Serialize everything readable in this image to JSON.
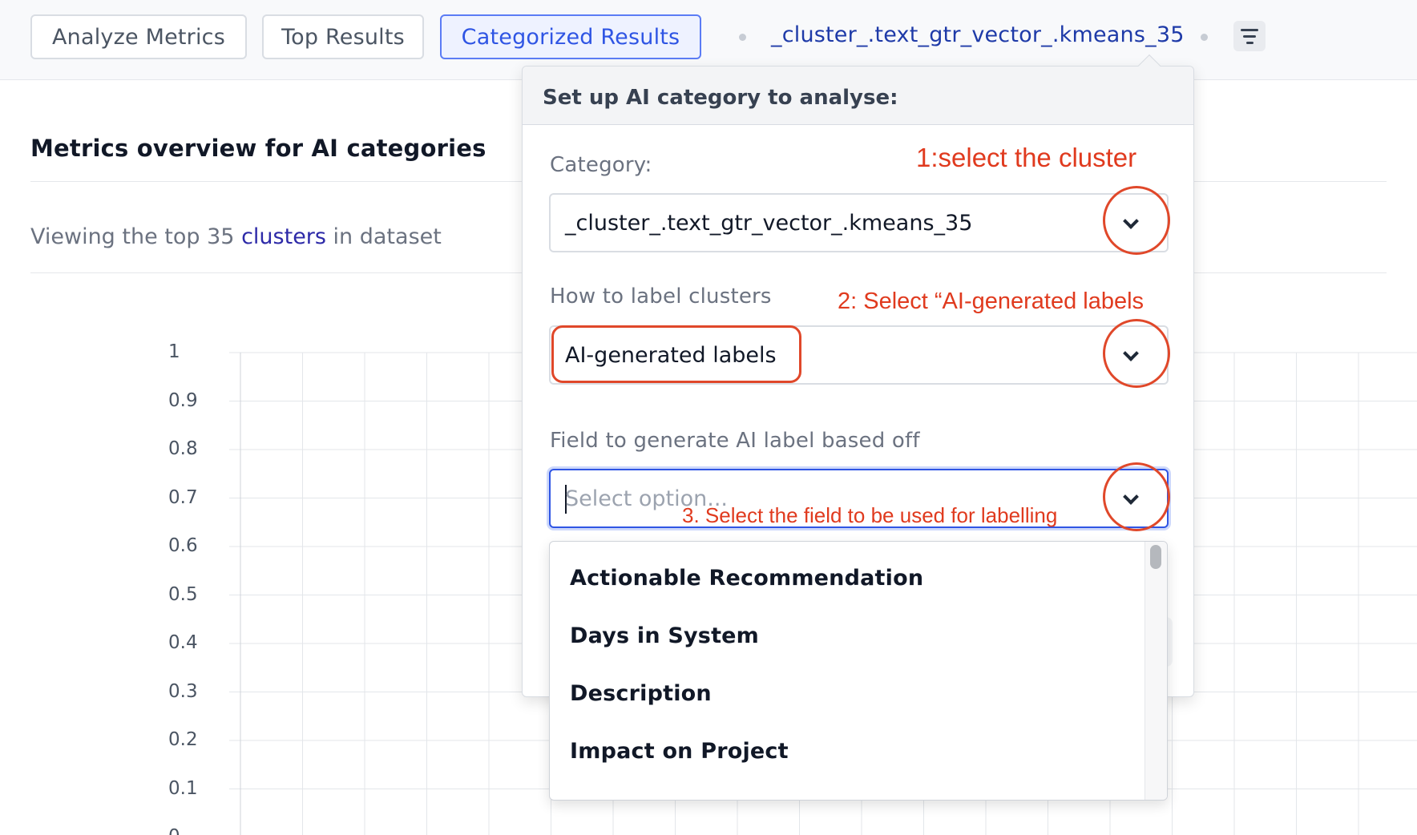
{
  "tabs": [
    {
      "label": "Analyze Metrics",
      "active": false
    },
    {
      "label": "Top Results",
      "active": false
    },
    {
      "label": "Categorized Results",
      "active": true
    }
  ],
  "breadcrumb": "_cluster_.text_gtr_vector_.kmeans_35",
  "filter_icon": "filter-lines-icon",
  "main": {
    "title": "Metrics overview for AI categories",
    "viewing_prefix": "Viewing the top 35 ",
    "viewing_highlight": "clusters",
    "viewing_suffix": " in dataset"
  },
  "chart_data": {
    "type": "bar",
    "title": "",
    "xlabel": "",
    "ylabel": "",
    "categories": [],
    "values": [],
    "ylim": [
      0,
      1
    ],
    "yticks": [
      "1",
      "0.9",
      "0.8",
      "0.7",
      "0.6",
      "0.5",
      "0.4",
      "0.3",
      "0.2",
      "0.1",
      "0"
    ],
    "grid": true
  },
  "popover": {
    "header": "Set up AI category to analyse:",
    "category_label": "Category:",
    "category_value": "_cluster_.text_gtr_vector_.kmeans_35",
    "label_method_label": "How to label clusters",
    "label_method_value": "AI-generated labels",
    "field_label": "Field to generate AI label based off",
    "field_placeholder": "Select option...",
    "options": [
      "Actionable Recommendation",
      "Days in System",
      "Description",
      "Impact on Project"
    ]
  },
  "annotations": {
    "step1": "1:select the cluster",
    "step2": "2: Select “AI-generated labels",
    "step3": "3. Select the field to be used for labelling",
    "color": "#e03a1e"
  }
}
